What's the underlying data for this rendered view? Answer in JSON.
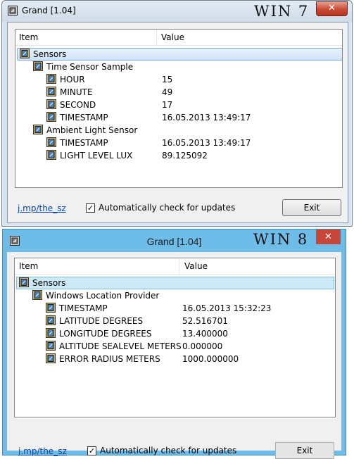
{
  "win7": {
    "title": "Grand [1.04]",
    "os_label": "WIN 7",
    "close_glyph": "✕",
    "columns": {
      "item": "Item",
      "value": "Value"
    },
    "root": "Sensors",
    "groups": [
      {
        "label": "Time Sensor Sample",
        "rows": [
          {
            "label": "HOUR",
            "value": "15"
          },
          {
            "label": "MINUTE",
            "value": "49"
          },
          {
            "label": "SECOND",
            "value": "17"
          },
          {
            "label": "TIMESTAMP",
            "value": "16.05.2013 13:49:17"
          }
        ]
      },
      {
        "label": "Ambient Light Sensor",
        "rows": [
          {
            "label": "TIMESTAMP",
            "value": "16.05.2013 13:49:17"
          },
          {
            "label": "LIGHT LEVEL LUX",
            "value": "89.125092"
          }
        ]
      }
    ],
    "link": "j.mp/the_sz",
    "checkbox_label": "Automatically check for updates",
    "checkbox_checked": true,
    "exit_label": "Exit"
  },
  "win8": {
    "title": "Grand [1.04]",
    "os_label": "WIN 8",
    "close_glyph": "✕",
    "columns": {
      "item": "Item",
      "value": "Value"
    },
    "root": "Sensors",
    "groups": [
      {
        "label": "Windows Location Provider",
        "rows": [
          {
            "label": "TIMESTAMP",
            "value": "16.05.2013 15:32:23"
          },
          {
            "label": "LATITUDE DEGREES",
            "value": "52.516701"
          },
          {
            "label": "LONGITUDE DEGREES",
            "value": "13.400000"
          },
          {
            "label": "ALTITUDE SEALEVEL METERS",
            "value": "0.000000"
          },
          {
            "label": "ERROR RADIUS METERS",
            "value": "1000.000000"
          }
        ]
      }
    ],
    "link": "j.mp/the_sz",
    "checkbox_label": "Automatically check for updates",
    "checkbox_checked": true,
    "exit_label": "Exit"
  },
  "icons": {
    "app": "grand-app-icon",
    "sensor": "sensor-icon"
  }
}
